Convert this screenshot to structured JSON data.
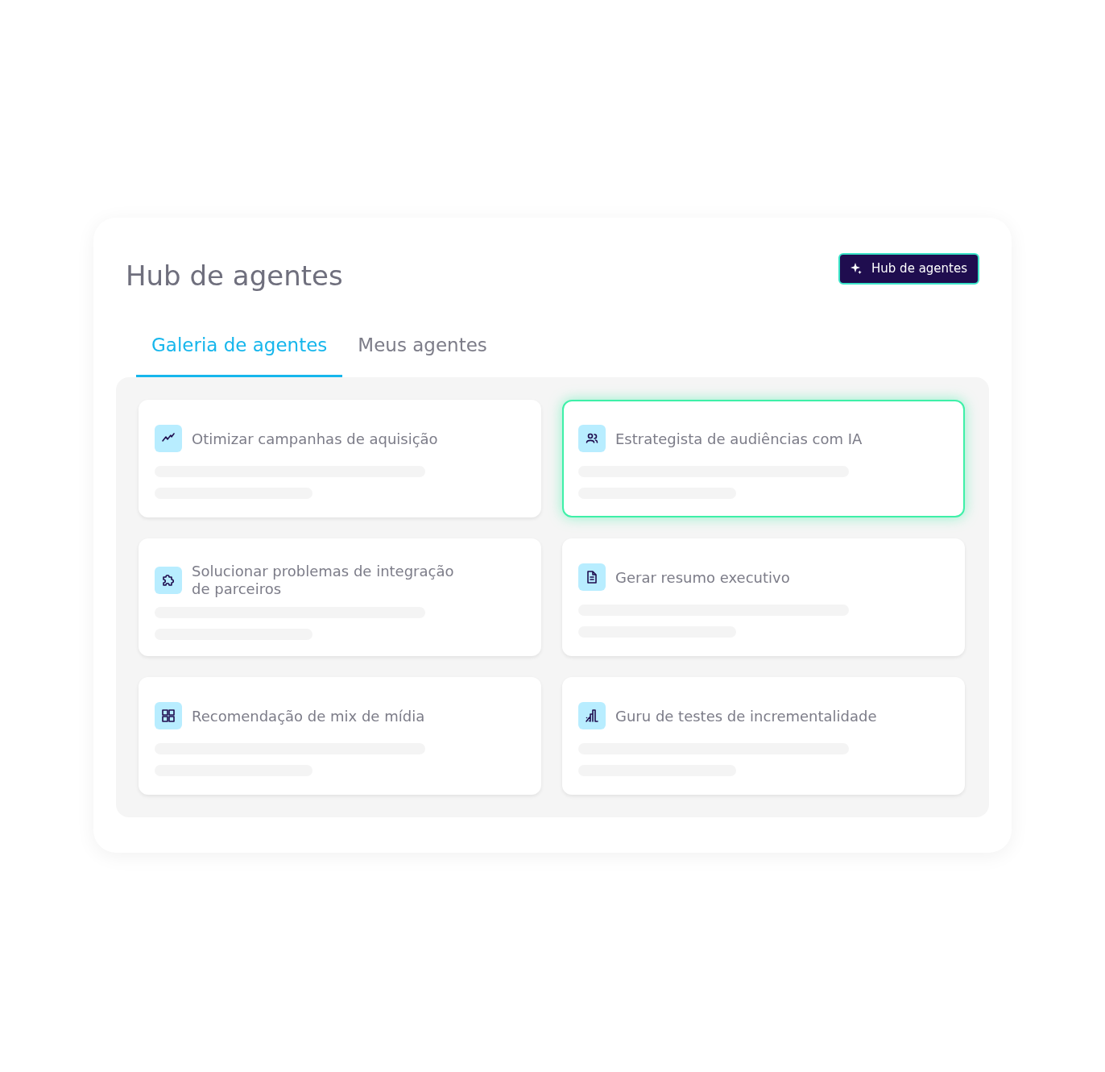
{
  "title": "Hub de agentes",
  "badge_button": {
    "label": "Hub de agentes"
  },
  "tabs": [
    {
      "label": "Galeria de agentes",
      "selected": true
    },
    {
      "label": "Meus agentes",
      "selected": false
    }
  ],
  "agents": [
    {
      "kind": "trend",
      "title": "Otimizar campanhas de aquisição",
      "highlighted": false
    },
    {
      "kind": "people",
      "title": "Estrategista de audiências com IA",
      "highlighted": true
    },
    {
      "kind": "puzzle",
      "title": "Solucionar problemas de integração de parceiros",
      "highlighted": false
    },
    {
      "kind": "document",
      "title": "Gerar resumo executivo",
      "highlighted": false
    },
    {
      "kind": "grid",
      "title": "Recomendação de mix de mídia",
      "highlighted": false
    },
    {
      "kind": "chart",
      "title": "Guru de testes de incrementalidade",
      "highlighted": false
    }
  ]
}
